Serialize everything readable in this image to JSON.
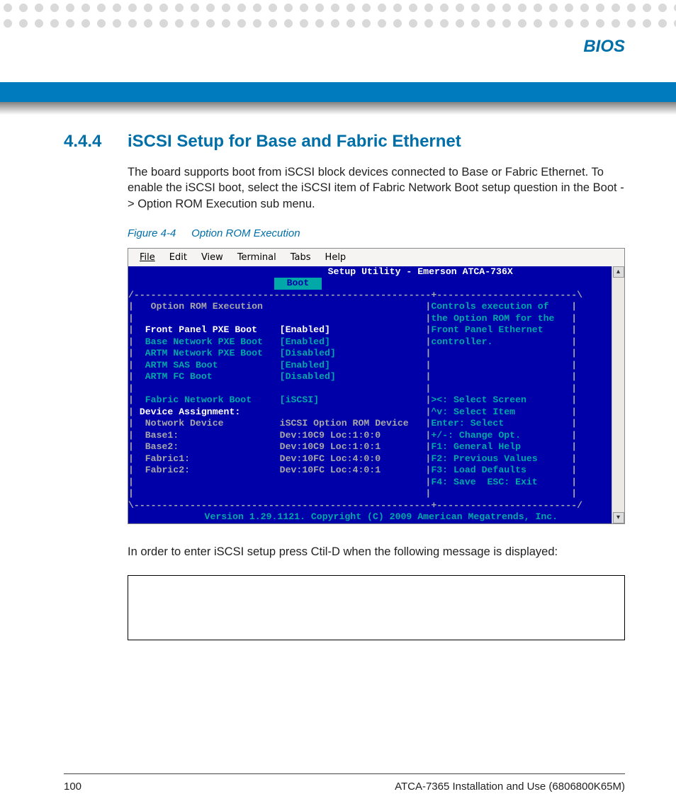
{
  "header": {
    "chapter": "BIOS"
  },
  "section": {
    "number": "4.4.4",
    "title": "iSCSI Setup for Base and Fabric Ethernet",
    "para1": "The board supports boot from iSCSI block devices connected to Base or Fabric Ethernet. To enable the iSCSI boot, select the iSCSI item of Fabric Network Boot setup question in the Boot -> Option ROM Execution sub menu."
  },
  "figure": {
    "label": "Figure 4-4",
    "title": "Option ROM Execution",
    "menubar": [
      "File",
      "Edit",
      "View",
      "Terminal",
      "Tabs",
      "Help"
    ],
    "setup_title": "Setup Utility - Emerson ATCA-736X",
    "tab": "Boot",
    "left_heading": "Option ROM Execution",
    "options": [
      {
        "label": "Front Panel PXE Boot",
        "value": "[Enabled]",
        "selected": true
      },
      {
        "label": "Base Network PXE Boot",
        "value": "[Enabled]",
        "selected": false
      },
      {
        "label": "ARTM Network PXE Boot",
        "value": "[Disabled]",
        "selected": false
      },
      {
        "label": "ARTM SAS Boot",
        "value": "[Enabled]",
        "selected": false
      },
      {
        "label": "ARTM FC Boot",
        "value": "[Disabled]",
        "selected": false
      }
    ],
    "fabric": {
      "label": "Fabric Network Boot",
      "value": "[iSCSI]"
    },
    "device_heading": "Device Assignment:",
    "devices": [
      {
        "label": "Notwork Device",
        "value": "iSCSI Option ROM Device"
      },
      {
        "label": "Base1:",
        "value": "Dev:10C9 Loc:1:0:0"
      },
      {
        "label": "Base2:",
        "value": "Dev:10C9 Loc:1:0:1"
      },
      {
        "label": "Fabric1:",
        "value": "Dev:10FC Loc:4:0:0"
      },
      {
        "label": "Fabric2:",
        "value": "Dev:10FC Loc:4:0:1"
      }
    ],
    "help_top": [
      "Controls execution of",
      "the Option ROM for the",
      "Front Panel Ethernet",
      "controller."
    ],
    "help_keys": [
      "><: Select Screen",
      "^v: Select Item",
      "Enter: Select",
      "+/-: Change Opt.",
      "F1: General Help",
      "F2: Previous Values",
      "F3: Load Defaults",
      "F4: Save  ESC: Exit"
    ],
    "version": "Version 1.29.1121. Copyright (C) 2009 American Megatrends, Inc."
  },
  "para2": "In order to enter iSCSI setup press Ctil-D when the following message is displayed:",
  "footer": {
    "page": "100",
    "doc": "ATCA-7365 Installation and Use (6806800K65M)"
  }
}
